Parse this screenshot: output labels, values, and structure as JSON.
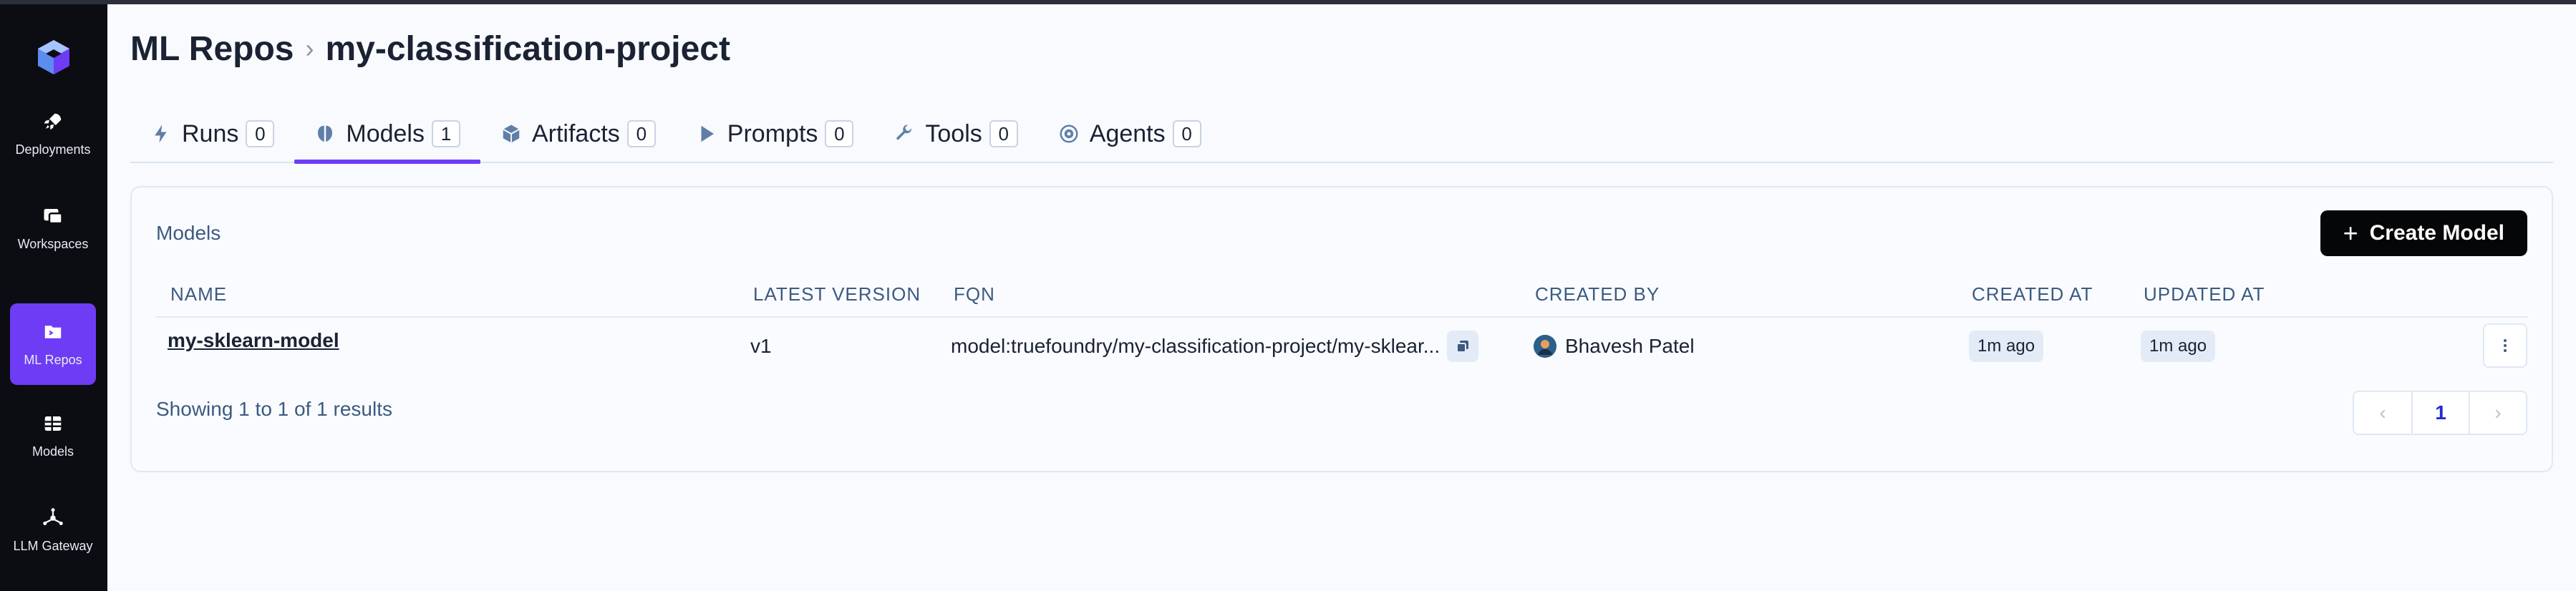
{
  "sidebar": {
    "items": [
      {
        "label": "Deployments",
        "icon": "rocket-icon"
      },
      {
        "label": "Workspaces",
        "icon": "workspaces-icon"
      },
      {
        "label": "ML Repos",
        "icon": "folder-icon",
        "active": true
      },
      {
        "label": "Models",
        "icon": "grid-icon"
      },
      {
        "label": "LLM Gateway",
        "icon": "gateway-icon"
      }
    ]
  },
  "breadcrumb": {
    "root": "ML Repos",
    "separator": "›",
    "current": "my-classification-project"
  },
  "tabs": [
    {
      "label": "Runs",
      "count": "0",
      "icon": "bolt-icon"
    },
    {
      "label": "Models",
      "count": "1",
      "icon": "brain-icon",
      "active": true
    },
    {
      "label": "Artifacts",
      "count": "0",
      "icon": "cube-icon"
    },
    {
      "label": "Prompts",
      "count": "0",
      "icon": "play-icon"
    },
    {
      "label": "Tools",
      "count": "0",
      "icon": "wrench-icon"
    },
    {
      "label": "Agents",
      "count": "0",
      "icon": "agent-icon"
    }
  ],
  "models_card": {
    "title": "Models",
    "create_button": "Create Model",
    "columns": [
      "NAME",
      "LATEST VERSION",
      "FQN",
      "CREATED BY",
      "CREATED AT",
      "UPDATED AT"
    ],
    "rows": [
      {
        "name": "my-sklearn-model",
        "latest_version": "v1",
        "fqn": "model:truefoundry/my-classification-project/my-sklear...",
        "created_by": "Bhavesh Patel",
        "created_at": "1m ago",
        "updated_at": "1m ago"
      }
    ],
    "showing_text": "Showing 1 to 1 of 1 results",
    "pagination": {
      "prev": "‹",
      "current_page": "1",
      "next": "›"
    }
  },
  "colors": {
    "accent": "#6e3cf5",
    "sidebar_bg": "#0b0d12",
    "button_bg": "#050608"
  }
}
